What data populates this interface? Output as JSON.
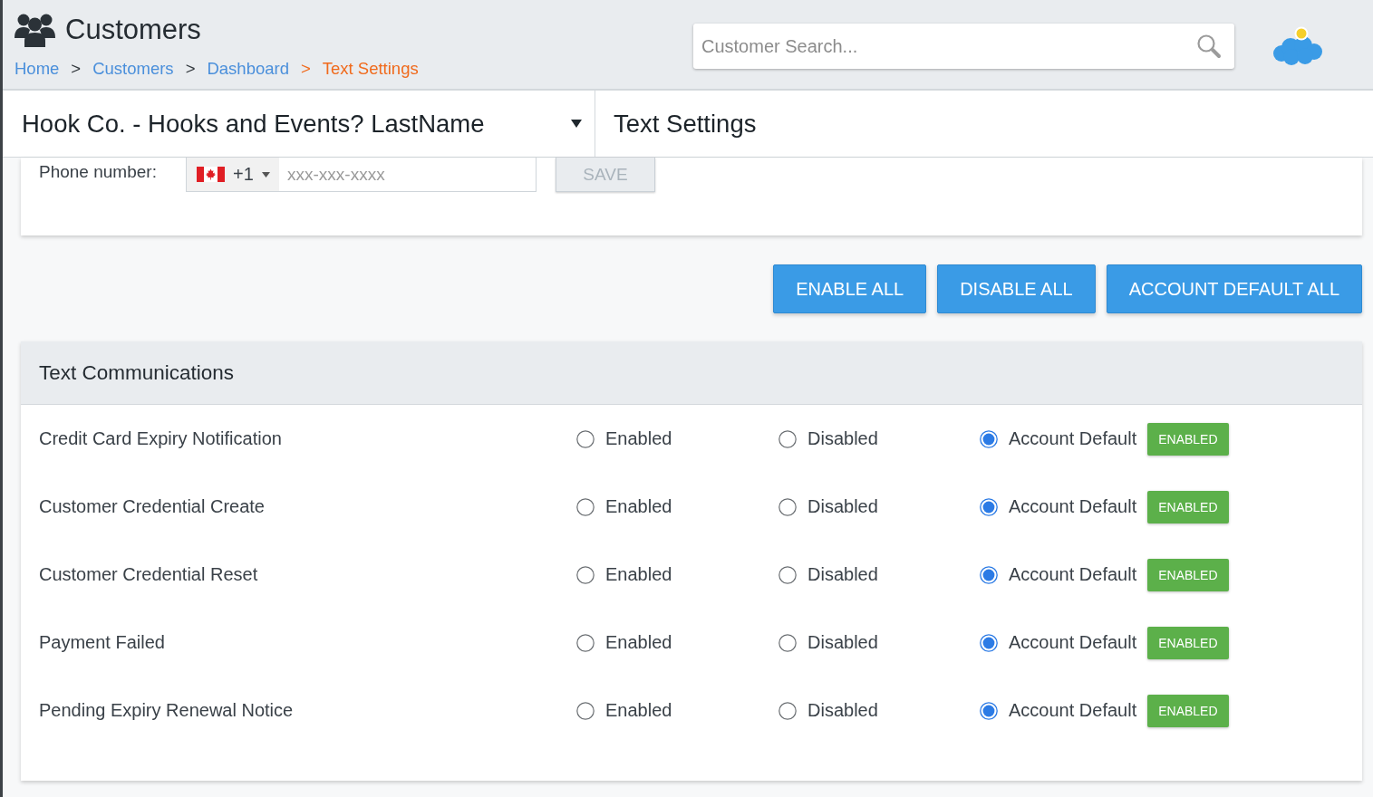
{
  "header": {
    "title": "Customers",
    "breadcrumb": [
      {
        "label": "Home",
        "selected": false
      },
      {
        "separator": ">",
        "label": "Customers",
        "selected": false
      },
      {
        "separator": ">",
        "label": "Dashboard",
        "selected": false
      },
      {
        "separator": ">",
        "label": "Text Settings",
        "selected": true
      }
    ],
    "search": {
      "placeholder": "Customer Search..."
    }
  },
  "context_bar": {
    "customer": "Hook Co. - Hooks and Events? LastName",
    "page_title": "Text Settings"
  },
  "phone_card": {
    "label": "Phone number:",
    "country_code": "+1",
    "placeholder": "xxx-xxx-xxxx",
    "save_button": {
      "label": "SAVE",
      "disabled": true
    }
  },
  "bulk_actions": [
    "ENABLE ALL",
    "DISABLE ALL",
    "ACCOUNT DEFAULT ALL"
  ],
  "communications": {
    "title": "Text Communications",
    "rows": [
      {
        "name": "Credit Card Expiry Notification",
        "options": [
          {
            "label": "Enabled",
            "selected": false
          },
          {
            "label": "Disabled",
            "selected": false
          },
          {
            "label": "Account Default",
            "selected": true
          }
        ],
        "badge": "ENABLED"
      },
      {
        "name": "Customer Credential Create",
        "options": [
          {
            "label": "Enabled",
            "selected": false
          },
          {
            "label": "Disabled",
            "selected": false
          },
          {
            "label": "Account Default",
            "selected": true
          }
        ],
        "badge": "ENABLED"
      },
      {
        "name": "Customer Credential Reset",
        "options": [
          {
            "label": "Enabled",
            "selected": false
          },
          {
            "label": "Disabled",
            "selected": false
          },
          {
            "label": "Account Default",
            "selected": true
          }
        ],
        "badge": "ENABLED"
      },
      {
        "name": "Payment Failed",
        "options": [
          {
            "label": "Enabled",
            "selected": false
          },
          {
            "label": "Disabled",
            "selected": false
          },
          {
            "label": "Account Default",
            "selected": true
          }
        ],
        "badge": "ENABLED"
      },
      {
        "name": "Pending Expiry Renewal Notice",
        "options": [
          {
            "label": "Enabled",
            "selected": false
          },
          {
            "label": "Disabled",
            "selected": false
          },
          {
            "label": "Account Default",
            "selected": true
          }
        ],
        "badge": "ENABLED"
      }
    ]
  }
}
